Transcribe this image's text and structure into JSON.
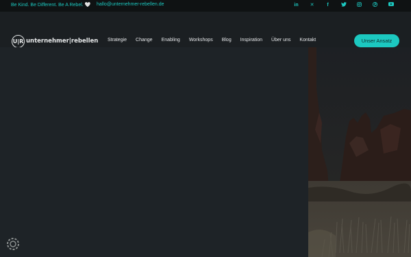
{
  "topbar": {
    "slogan": "Be Kind. Be Different. Be A Rebel. 🤍",
    "email": "hallo@unternehmer-rebellen.de",
    "social_icons": [
      "linkedin-icon",
      "xing-icon",
      "facebook-icon",
      "twitter-icon",
      "instagram-icon",
      "pinterest-icon",
      "youtube-icon"
    ],
    "social_glyphs": [
      "in",
      "✕",
      "f",
      "🐦",
      "◎",
      "℗",
      "▶"
    ]
  },
  "nav": {
    "logo_mark": "U|R",
    "logo_text": "unternehmer|rebellen",
    "menu": [
      "Strategie",
      "Change",
      "Enabling",
      "Workshops",
      "Blog",
      "Inspiration",
      "Über uns",
      "Kontakt"
    ],
    "cta_label": "Unser Ansatz"
  },
  "colors": {
    "accent": "#1cc8c0",
    "background": "#1e2327",
    "topbar": "#0f1213"
  }
}
